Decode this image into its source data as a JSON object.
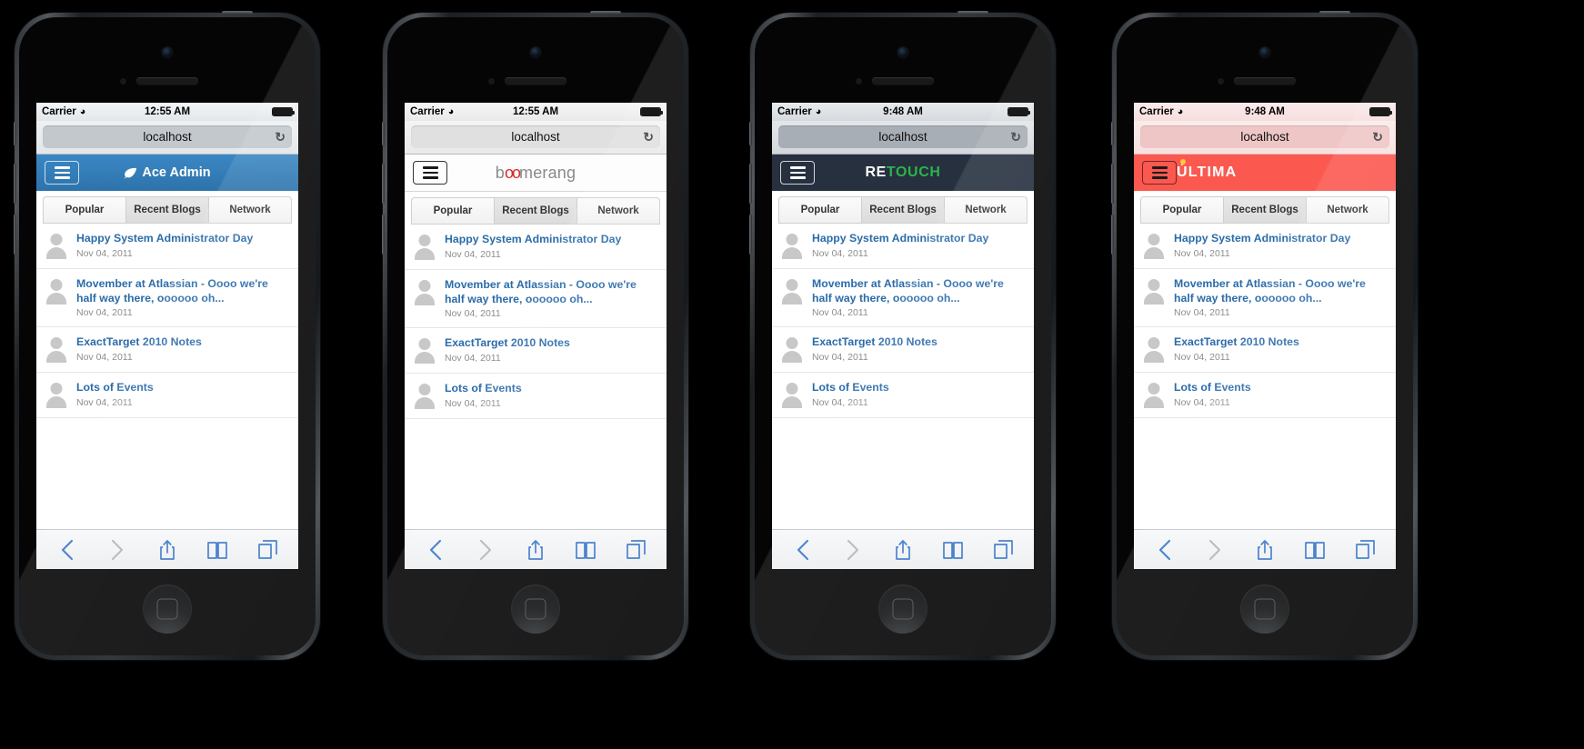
{
  "phones": [
    {
      "theme": "ace",
      "status": {
        "carrier": "Carrier",
        "time": "12:55 AM",
        "wifi_icon": "wifi-icon",
        "battery_icon": "battery-icon"
      },
      "browser": {
        "url": "localhost",
        "reload_icon": "reload-icon"
      },
      "navbar": {
        "menu_icon": "hamburger-icon",
        "brand": "Ace Admin",
        "leaf_icon": "leaf-icon",
        "bg": "#2e73ab"
      },
      "tabs": [
        {
          "label": "Popular",
          "active": false
        },
        {
          "label": "Recent Blogs",
          "active": true
        },
        {
          "label": "Network",
          "active": false
        }
      ]
    },
    {
      "theme": "boom",
      "status": {
        "carrier": "Carrier",
        "time": "12:55 AM",
        "wifi_icon": "wifi-icon",
        "battery_icon": "battery-icon"
      },
      "browser": {
        "url": "localhost",
        "reload_icon": "reload-icon"
      },
      "navbar": {
        "menu_icon": "hamburger-icon",
        "brand": "boomerang",
        "brand_prefix": "b",
        "brand_accent": "oo",
        "brand_suffix": "merang",
        "bg": "#fdfdfd",
        "accent": "#d62b2b"
      },
      "tabs": [
        {
          "label": "Popular",
          "active": false
        },
        {
          "label": "Recent Blogs",
          "active": true
        },
        {
          "label": "Network",
          "active": false
        }
      ]
    },
    {
      "theme": "ret",
      "status": {
        "carrier": "Carrier",
        "time": "9:48 AM",
        "wifi_icon": "wifi-icon",
        "battery_icon": "battery-icon"
      },
      "browser": {
        "url": "localhost",
        "reload_icon": "reload-icon"
      },
      "navbar": {
        "menu_icon": "hamburger-icon",
        "brand": "RETOUCH",
        "brand_prefix": "RE",
        "brand_suffix": "TOUCH",
        "bg": "#26303f",
        "accent": "#2cb34a"
      },
      "tabs": [
        {
          "label": "Popular",
          "active": false
        },
        {
          "label": "Recent Blogs",
          "active": true
        },
        {
          "label": "Network",
          "active": false
        }
      ]
    },
    {
      "theme": "ult",
      "status": {
        "carrier": "Carrier",
        "time": "9:48 AM",
        "wifi_icon": "wifi-icon",
        "battery_icon": "battery-icon"
      },
      "browser": {
        "url": "localhost",
        "reload_icon": "reload-icon"
      },
      "navbar": {
        "menu_icon": "hamburger-icon",
        "brand": "ÚLTIMA",
        "bg": "#fb5850",
        "accent": "#ffc83d"
      },
      "tabs": [
        {
          "label": "Popular",
          "active": false
        },
        {
          "label": "Recent Blogs",
          "active": true
        },
        {
          "label": "Network",
          "active": false
        }
      ]
    }
  ],
  "list": [
    {
      "title": "Happy System Administrator Day",
      "date": "Nov 04, 2011"
    },
    {
      "title": "Movember at Atlassian - Oooo we're half way there, oooooo oh...",
      "date": "Nov 04, 2011"
    },
    {
      "title": "ExactTarget 2010 Notes",
      "date": "Nov 04, 2011"
    },
    {
      "title": "Lots of Events",
      "date": "Nov 04, 2011"
    }
  ],
  "safari_toolbar": [
    {
      "name": "back-icon",
      "enabled": true
    },
    {
      "name": "forward-icon",
      "enabled": false
    },
    {
      "name": "share-icon",
      "enabled": true
    },
    {
      "name": "bookmarks-icon",
      "enabled": true
    },
    {
      "name": "tabs-icon",
      "enabled": true
    }
  ]
}
